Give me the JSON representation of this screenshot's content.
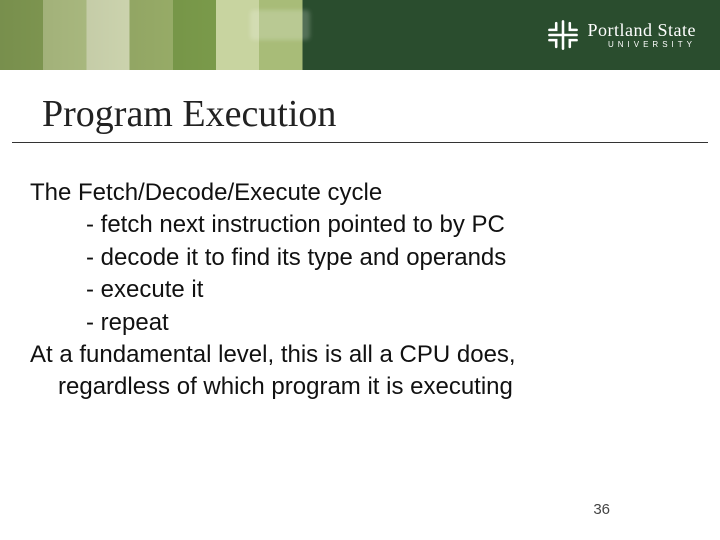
{
  "brand": {
    "name": "Portland State",
    "sub": "UNIVERSITY"
  },
  "title": "Program Execution",
  "intro": "The Fetch/Decode/Execute cycle",
  "bullets": [
    "- fetch next instruction pointed to by PC",
    "- decode it to find its type and operands",
    "- execute it",
    "- repeat"
  ],
  "conclusion_line1": "At a fundamental level, this is all a CPU does,",
  "conclusion_line2": "regardless of which program it is executing",
  "page_number": "36"
}
